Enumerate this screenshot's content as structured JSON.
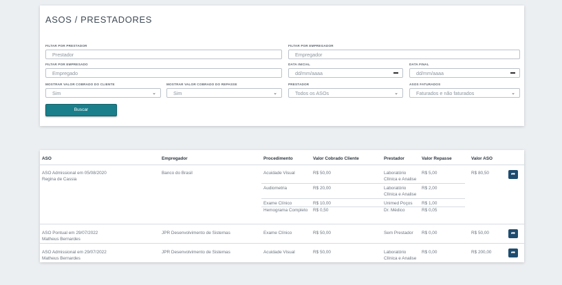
{
  "page": {
    "title": "ASOS / PRESTADORES"
  },
  "filters": {
    "prestador": {
      "label": "FILTAR POR PRESTADOR",
      "placeholder": "Prestador"
    },
    "empregador": {
      "label": "FILTAR POR EMPREGADOR",
      "placeholder": "Empregador"
    },
    "empresado": {
      "label": "FILTAR POR EMPRESADO",
      "placeholder": "Empregado"
    },
    "data_inicial": {
      "label": "DATA INICIAL",
      "placeholder": "dd/mm/aaaa"
    },
    "data_final": {
      "label": "DATA FINAL",
      "placeholder": "dd/mm/aaaa"
    },
    "valor_cliente": {
      "label": "MOSTRAR VALOR COBRADO DO CLIENTE",
      "value": "Sim"
    },
    "valor_repasse": {
      "label": "MOSTRAR VALOR COBRADO DO REPASSE",
      "value": "Sim"
    },
    "prestador_select": {
      "label": "PRESTADOR",
      "value": "Todos os ASOs"
    },
    "asos_faturados": {
      "label": "ASOS FATURADOS",
      "value": "Faturados e não faturados"
    },
    "search_label": "Buscar"
  },
  "icons": {
    "calendar": "calendar-icon",
    "chevron": "chevron-down-icon",
    "action": "share-arrow-icon"
  },
  "colors": {
    "button": "#1a7f8a",
    "action": "#1e4c6e"
  },
  "table": {
    "headers": {
      "aso": "ASO",
      "empregador": "Empregador",
      "procedimento": "Procedimento",
      "valor_cliente": "Valor Cobrado Cliente",
      "prestador": "Prestador",
      "valor_repasse": "Valor Repasse",
      "valor_aso": "Valor ASO"
    },
    "rows": [
      {
        "aso": "ASO Admissional em 05/08/2020",
        "person": "Regina de Cassia",
        "empregador": "Banco do Brasil",
        "valor_aso": "R$ 80,50",
        "procedures": [
          {
            "procedimento": "Acuidade Visual",
            "valor": "R$ 50,00",
            "prestador": [
              "Laboratório",
              "Clínica e Analise"
            ],
            "repasse": "R$ 5,00"
          },
          {
            "procedimento": "Audiometria",
            "valor": "R$ 20,00",
            "prestador": [
              "Laboratório",
              "Clínica e Analise"
            ],
            "repasse": "R$ 2,00"
          },
          {
            "procedimento": "Exame Clínico",
            "valor": "R$ 10,00",
            "prestador": [
              "Unimed Poços"
            ],
            "repasse": "R$ 1,00"
          },
          {
            "procedimento": "Hemograma Completo",
            "valor": "R$ 0,50",
            "prestador": [
              "Dr. Médico"
            ],
            "repasse": "R$ 0,05"
          }
        ]
      },
      {
        "aso": "ASO Pontual em 29/07/2022",
        "person": "Matheus Bernardes",
        "empregador": "JPR Desenvolvimento de Sistemas",
        "valor_aso": "R$ 50,00",
        "procedures": [
          {
            "procedimento": "Exame Clínico",
            "valor": "R$ 50,00",
            "prestador": [
              "Sem Prestador"
            ],
            "repasse": "R$ 0,00"
          }
        ]
      },
      {
        "aso": "ASO Admissional em 29/07/2022",
        "person": "Matheus Bernardes",
        "empregador": "JPR Desenvolvimento de Sistemas",
        "valor_aso": "R$ 200,00",
        "procedures": [
          {
            "procedimento": "Acuidade Visual",
            "valor": "R$ 50,00",
            "prestador": [
              "Laboratório",
              "Clínica e Analise"
            ],
            "repasse": "R$ 0,00"
          }
        ]
      }
    ]
  }
}
